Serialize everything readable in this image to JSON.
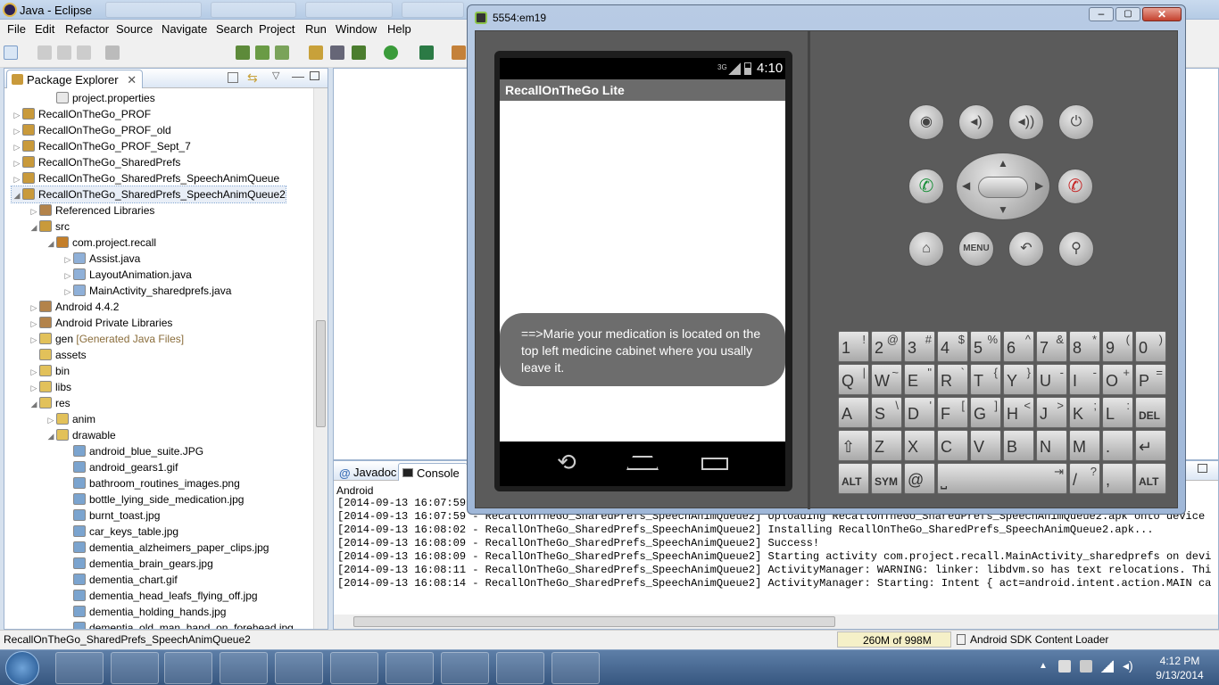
{
  "window": {
    "title": "Java - Eclipse"
  },
  "menu": [
    "File",
    "Edit",
    "Refactor",
    "Source",
    "Navigate",
    "Search",
    "Project",
    "Run",
    "Window",
    "Help"
  ],
  "package_explorer": {
    "tab_label": "Package Explorer",
    "rows": [
      {
        "label": "project.properties",
        "depth": 2,
        "twisty": "",
        "icon": "file-icon"
      },
      {
        "label": "RecallOnTheGo_PROF",
        "depth": 0,
        "twisty": "▷",
        "icon": "project-icon"
      },
      {
        "label": "RecallOnTheGo_PROF_old",
        "depth": 0,
        "twisty": "▷",
        "icon": "project-icon"
      },
      {
        "label": "RecallOnTheGo_PROF_Sept_7",
        "depth": 0,
        "twisty": "▷",
        "icon": "project-icon"
      },
      {
        "label": "RecallOnTheGo_SharedPrefs",
        "depth": 0,
        "twisty": "▷",
        "icon": "project-icon"
      },
      {
        "label": "RecallOnTheGo_SharedPrefs_SpeechAnimQueue",
        "depth": 0,
        "twisty": "▷",
        "icon": "project-icon"
      },
      {
        "label": "RecallOnTheGo_SharedPrefs_SpeechAnimQueue2",
        "depth": 0,
        "twisty": "◢",
        "icon": "project-icon",
        "selected": true
      },
      {
        "label": "Referenced Libraries",
        "depth": 1,
        "twisty": "▷",
        "icon": "library-icon"
      },
      {
        "label": "src",
        "depth": 1,
        "twisty": "◢",
        "icon": "source-folder-icon"
      },
      {
        "label": "com.project.recall",
        "depth": 2,
        "twisty": "◢",
        "icon": "package-icon"
      },
      {
        "label": "Assist.java",
        "depth": 3,
        "twisty": "▷",
        "icon": "java-file-icon"
      },
      {
        "label": "LayoutAnimation.java",
        "depth": 3,
        "twisty": "▷",
        "icon": "java-file-icon"
      },
      {
        "label": "MainActivity_sharedprefs.java",
        "depth": 3,
        "twisty": "▷",
        "icon": "java-file-icon"
      },
      {
        "label": "Android 4.4.2",
        "depth": 1,
        "twisty": "▷",
        "icon": "library-icon"
      },
      {
        "label": "Android Private Libraries",
        "depth": 1,
        "twisty": "▷",
        "icon": "library-icon"
      },
      {
        "label": "gen",
        "suffix": " [Generated Java Files]",
        "depth": 1,
        "twisty": "▷",
        "icon": "folder-icon"
      },
      {
        "label": "assets",
        "depth": 1,
        "twisty": "",
        "icon": "folder-icon"
      },
      {
        "label": "bin",
        "depth": 1,
        "twisty": "▷",
        "icon": "folder-icon"
      },
      {
        "label": "libs",
        "depth": 1,
        "twisty": "▷",
        "icon": "folder-icon"
      },
      {
        "label": "res",
        "depth": 1,
        "twisty": "◢",
        "icon": "folder-icon"
      },
      {
        "label": "anim",
        "depth": 2,
        "twisty": "▷",
        "icon": "folder-icon"
      },
      {
        "label": "drawable",
        "depth": 2,
        "twisty": "◢",
        "icon": "folder-icon"
      },
      {
        "label": "android_blue_suite.JPG",
        "depth": 3,
        "twisty": "",
        "icon": "image-file-icon"
      },
      {
        "label": "android_gears1.gif",
        "depth": 3,
        "twisty": "",
        "icon": "image-file-icon"
      },
      {
        "label": "bathroom_routines_images.png",
        "depth": 3,
        "twisty": "",
        "icon": "image-file-icon"
      },
      {
        "label": "bottle_lying_side_medication.jpg",
        "depth": 3,
        "twisty": "",
        "icon": "image-file-icon"
      },
      {
        "label": "burnt_toast.jpg",
        "depth": 3,
        "twisty": "",
        "icon": "image-file-icon"
      },
      {
        "label": "car_keys_table.jpg",
        "depth": 3,
        "twisty": "",
        "icon": "image-file-icon"
      },
      {
        "label": "dementia_alzheimers_paper_clips.jpg",
        "depth": 3,
        "twisty": "",
        "icon": "image-file-icon"
      },
      {
        "label": "dementia_brain_gears.jpg",
        "depth": 3,
        "twisty": "",
        "icon": "image-file-icon"
      },
      {
        "label": "dementia_chart.gif",
        "depth": 3,
        "twisty": "",
        "icon": "image-file-icon"
      },
      {
        "label": "dementia_head_leafs_flying_off.jpg",
        "depth": 3,
        "twisty": "",
        "icon": "image-file-icon"
      },
      {
        "label": "dementia_holding_hands.jpg",
        "depth": 3,
        "twisty": "",
        "icon": "image-file-icon"
      },
      {
        "label": "dementia_old_man_hand_on_forehead.jpg",
        "depth": 3,
        "twisty": "",
        "icon": "image-file-icon"
      }
    ]
  },
  "console": {
    "tabs": [
      "Javadoc",
      "Console"
    ],
    "header": "Android",
    "lines": [
      "[2014-09-13 16:07:59 - RecallOnTheGo_SharedPrefs_SpeechAnimQueue2] ------------------------------",
      "[2014-09-13 16:07:59 - RecallOnTheGo_SharedPrefs_SpeechAnimQueue2] Uploading RecallOnTheGo_SharedPrefs_SpeechAnimQueue2.apk onto device 'em",
      "[2014-09-13 16:08:02 - RecallOnTheGo_SharedPrefs_SpeechAnimQueue2] Installing RecallOnTheGo_SharedPrefs_SpeechAnimQueue2.apk...",
      "[2014-09-13 16:08:09 - RecallOnTheGo_SharedPrefs_SpeechAnimQueue2] Success!",
      "[2014-09-13 16:08:09 - RecallOnTheGo_SharedPrefs_SpeechAnimQueue2] Starting activity com.project.recall.MainActivity_sharedprefs on device",
      "[2014-09-13 16:08:11 - RecallOnTheGo_SharedPrefs_SpeechAnimQueue2] ActivityManager: WARNING: linker: libdvm.so has text relocations. This i",
      "[2014-09-13 16:08:14 - RecallOnTheGo_SharedPrefs_SpeechAnimQueue2] ActivityManager: Starting: Intent { act=android.intent.action.MAIN cat=["
    ]
  },
  "status": {
    "selection": "RecallOnTheGo_SharedPrefs_SpeechAnimQueue2",
    "memory": "260M of 998M",
    "task": "Android SDK Content Loader"
  },
  "emulator": {
    "title": "5554:em19",
    "status_time": "4:10",
    "status_net": "3G",
    "app_title": "RecallOnTheGo Lite",
    "toast": "==>Marie your medication is located on the top left medicine cabinet where you usally leave it.",
    "hw_buttons": [
      {
        "name": "camera-icon",
        "glyph": "◉"
      },
      {
        "name": "volume-down-icon",
        "glyph": "◂)"
      },
      {
        "name": "volume-up-icon",
        "glyph": "◂))"
      },
      {
        "name": "power-icon",
        "glyph": "⏻"
      },
      {
        "name": "home-icon",
        "glyph": "⌂"
      },
      {
        "name": "menu-button",
        "glyph": "MENU"
      },
      {
        "name": "back-icon",
        "glyph": "↶"
      },
      {
        "name": "search-icon",
        "glyph": "⚲"
      }
    ],
    "keyboard": [
      [
        [
          "1",
          "!"
        ],
        [
          "2",
          "@"
        ],
        [
          "3",
          "#"
        ],
        [
          "4",
          "$"
        ],
        [
          "5",
          "%"
        ],
        [
          "6",
          "^"
        ],
        [
          "7",
          "&"
        ],
        [
          "8",
          "*"
        ],
        [
          "9",
          "("
        ],
        [
          "0",
          ")"
        ]
      ],
      [
        [
          "Q",
          "|"
        ],
        [
          "W",
          "~"
        ],
        [
          "E",
          "\""
        ],
        [
          "R",
          "`"
        ],
        [
          "T",
          "{"
        ],
        [
          "Y",
          "}"
        ],
        [
          "U",
          "-"
        ],
        [
          "I",
          "-"
        ],
        [
          "O",
          "+"
        ],
        [
          "P",
          "="
        ]
      ],
      [
        [
          "A",
          ""
        ],
        [
          "S",
          "\\"
        ],
        [
          "D",
          "'"
        ],
        [
          "F",
          "["
        ],
        [
          "G",
          "]"
        ],
        [
          "H",
          "<"
        ],
        [
          "J",
          ">"
        ],
        [
          "K",
          ";"
        ],
        [
          "L",
          ":"
        ],
        [
          "DEL",
          ""
        ]
      ],
      [
        [
          "⇧",
          ""
        ],
        [
          "Z",
          ""
        ],
        [
          "X",
          ""
        ],
        [
          "C",
          ""
        ],
        [
          "V",
          ""
        ],
        [
          "B",
          ""
        ],
        [
          "N",
          ""
        ],
        [
          "M",
          ""
        ],
        [
          ".",
          ""
        ],
        [
          "↵",
          ""
        ]
      ],
      [
        [
          "ALT",
          ""
        ],
        [
          "SYM",
          ""
        ],
        [
          "@",
          ""
        ],
        [
          "⎵",
          "⇥"
        ],
        [
          "/",
          "?"
        ],
        [
          ",",
          ""
        ],
        [
          "ALT",
          ""
        ]
      ]
    ]
  },
  "taskbar": {
    "time": "4:12 PM",
    "date": "9/13/2014"
  }
}
